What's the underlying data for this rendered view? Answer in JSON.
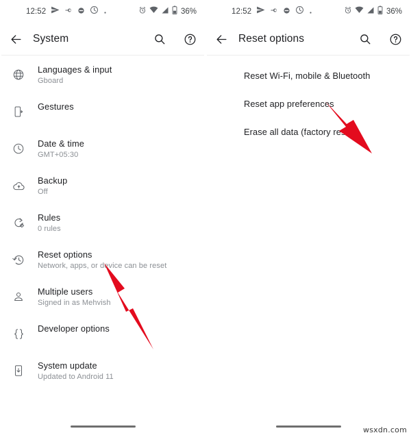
{
  "accent_red": "#e30b1e",
  "panels": [
    {
      "id": "system",
      "statusbar": {
        "time": "12:52",
        "left_icons": [
          "send-icon",
          "vpn-key-icon",
          "dark-circle-icon",
          "do-not-disturb-icon",
          "dot-icon"
        ],
        "right_icons": [
          "alarm-icon",
          "wifi-icon",
          "signal-icon",
          "battery-icon"
        ],
        "battery": "36%"
      },
      "appbar": {
        "back_icon": "back-arrow-icon",
        "title": "System",
        "search_icon": "search-icon",
        "help_icon": "help-icon"
      },
      "items": [
        {
          "icon": "globe-icon",
          "title": "Languages & input",
          "subtitle": "Gboard"
        },
        {
          "icon": "gestures-icon",
          "title": "Gestures",
          "subtitle": ""
        },
        {
          "icon": "clock-icon",
          "title": "Date & time",
          "subtitle": "GMT+05:30"
        },
        {
          "icon": "cloud-upload-icon",
          "title": "Backup",
          "subtitle": "Off"
        },
        {
          "icon": "rules-icon",
          "title": "Rules",
          "subtitle": "0 rules"
        },
        {
          "icon": "history-icon",
          "title": "Reset options",
          "subtitle": "Network, apps, or device can be reset"
        },
        {
          "icon": "person-icon",
          "title": "Multiple users",
          "subtitle": "Signed in as Mehvish"
        },
        {
          "icon": "braces-icon",
          "title": "Developer options",
          "subtitle": ""
        },
        {
          "icon": "system-update-icon",
          "title": "System update",
          "subtitle": "Updated to Android 11"
        }
      ]
    },
    {
      "id": "reset-options",
      "statusbar": {
        "time": "12:52",
        "left_icons": [
          "send-icon",
          "vpn-key-icon",
          "dark-circle-icon",
          "do-not-disturb-icon",
          "dot-icon"
        ],
        "right_icons": [
          "alarm-icon",
          "wifi-icon",
          "signal-icon",
          "battery-icon"
        ],
        "battery": "36%"
      },
      "appbar": {
        "back_icon": "back-arrow-icon",
        "title": "Reset options",
        "search_icon": "search-icon",
        "help_icon": "help-icon"
      },
      "items": [
        {
          "title": "Reset Wi-Fi, mobile & Bluetooth"
        },
        {
          "title": "Reset app preferences"
        },
        {
          "title": "Erase all data (factory reset)"
        }
      ]
    }
  ],
  "annotations": [
    {
      "name": "arrow-to-reset-options",
      "target": "Reset options"
    },
    {
      "name": "arrow-to-reset-app-preferences",
      "target": "Reset app preferences"
    }
  ],
  "watermark": "wsxdn.com"
}
